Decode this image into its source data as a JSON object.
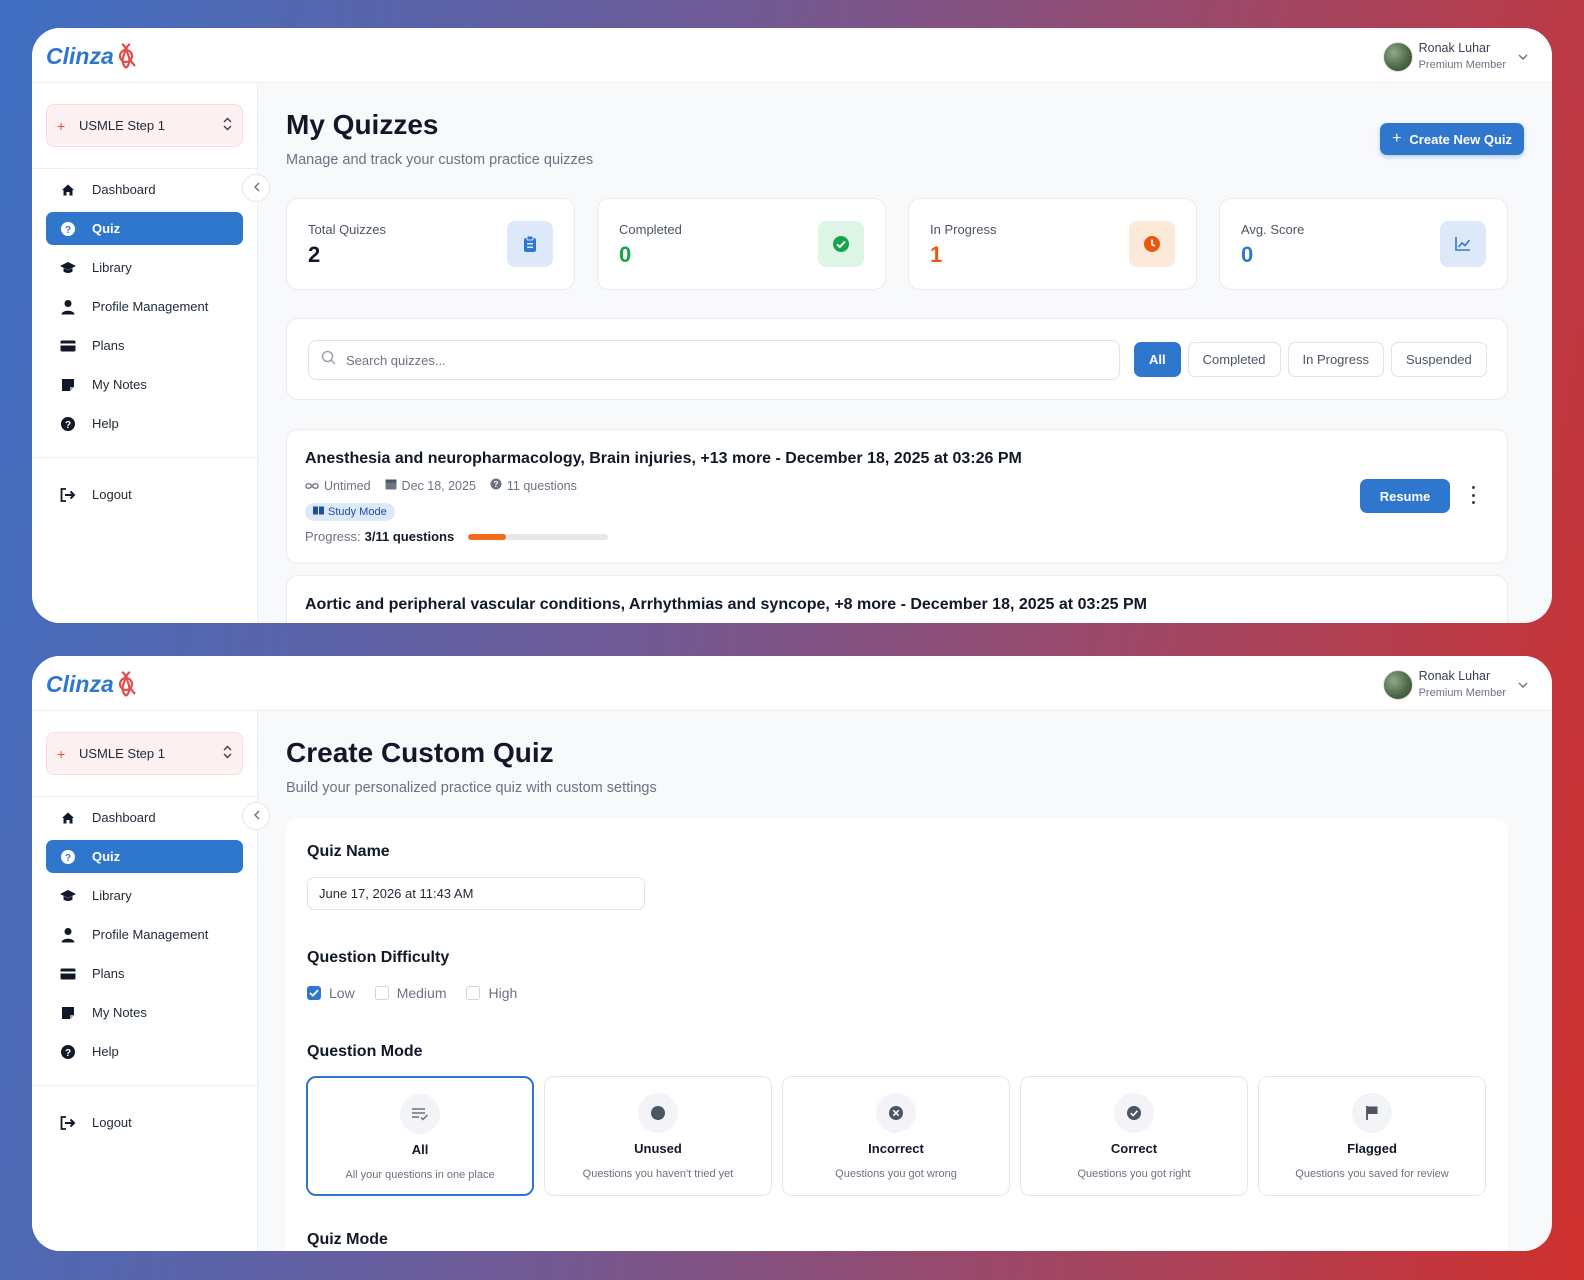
{
  "app": {
    "logo_text": "Clinza",
    "user_name": "Ronak Luhar",
    "user_role": "Premium Member"
  },
  "sidebar": {
    "exam": "USMLE Step 1",
    "items": [
      {
        "label": "Dashboard",
        "icon": "home-icon"
      },
      {
        "label": "Quiz",
        "icon": "question-circle-icon",
        "active": true
      },
      {
        "label": "Library",
        "icon": "graduation-cap-icon"
      },
      {
        "label": "Profile Management",
        "icon": "user-icon"
      },
      {
        "label": "Plans",
        "icon": "credit-card-icon"
      },
      {
        "label": "My Notes",
        "icon": "sticky-note-icon"
      },
      {
        "label": "Help",
        "icon": "help-circle-icon"
      }
    ],
    "logout": "Logout"
  },
  "my_quizzes": {
    "title": "My Quizzes",
    "subtitle": "Manage and track your custom practice quizzes",
    "create_label": "Create New Quiz",
    "stats": [
      {
        "label": "Total Quizzes",
        "value": "2",
        "color": "#111827",
        "icon": "clipboard-icon",
        "icon_bg": "#dde9f9",
        "icon_color": "#2f77cd"
      },
      {
        "label": "Completed",
        "value": "0",
        "color": "#16a34a",
        "icon": "check-circle-icon",
        "icon_bg": "#dcf5e4",
        "icon_color": "#16a34a"
      },
      {
        "label": "In Progress",
        "value": "1",
        "color": "#ea580c",
        "icon": "clock-icon",
        "icon_bg": "#fde9d8",
        "icon_color": "#ea580c"
      },
      {
        "label": "Avg. Score",
        "value": "0",
        "color": "#2f77cd",
        "icon": "line-chart-icon",
        "icon_bg": "#dde9f9",
        "icon_color": "#2f77cd"
      }
    ],
    "search_placeholder": "Search quizzes...",
    "tabs": [
      "All",
      "Completed",
      "In Progress",
      "Suspended"
    ],
    "active_tab": "All",
    "quizzes": [
      {
        "title": "Anesthesia and neuropharmacology, Brain injuries, +13 more - December 18, 2025 at 03:26 PM",
        "timing": "Untimed",
        "date": "Dec 18, 2025",
        "questions": "11 questions",
        "mode": "Study Mode",
        "progress_label": "Progress:",
        "progress_text": "3/11 questions",
        "progress_fraction": 0.273,
        "action": "Resume"
      },
      {
        "title": "Aortic and peripheral vascular conditions, Arrhythmias and syncope, +8 more - December 18, 2025 at 03:25 PM"
      }
    ]
  },
  "create_quiz": {
    "title": "Create Custom Quiz",
    "subtitle": "Build your personalized practice quiz with custom settings",
    "name_label": "Quiz Name",
    "name_value": "June 17, 2026 at 11:43 AM",
    "difficulty_label": "Question Difficulty",
    "difficulties": [
      {
        "label": "Low",
        "checked": true
      },
      {
        "label": "Medium",
        "checked": false
      },
      {
        "label": "High",
        "checked": false
      }
    ],
    "mode_label": "Question Mode",
    "modes": [
      {
        "name": "All",
        "desc": "All your questions in one place",
        "icon": "list-check-icon",
        "selected": true
      },
      {
        "name": "Unused",
        "desc": "Questions you haven't tried yet",
        "icon": "circle-dot-icon"
      },
      {
        "name": "Incorrect",
        "desc": "Questions you got wrong",
        "icon": "x-circle-icon"
      },
      {
        "name": "Correct",
        "desc": "Questions you got right",
        "icon": "check-circle-icon"
      },
      {
        "name": "Flagged",
        "desc": "Questions you saved for review",
        "icon": "flag-icon"
      }
    ],
    "next_section": "Quiz Mode"
  }
}
